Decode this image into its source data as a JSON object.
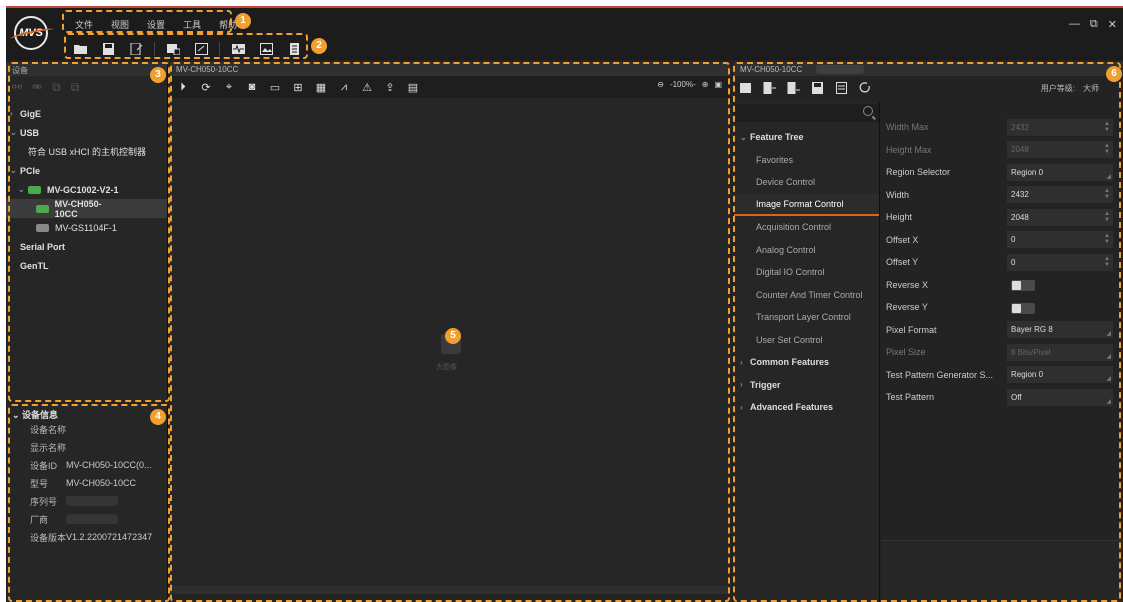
{
  "menu": [
    "文件",
    "视图",
    "设置",
    "工具",
    "帮助"
  ],
  "toolbar_icons": [
    "open-folder-icon",
    "save-icon",
    "save-as-icon",
    "import-icon",
    "fullscreen-icon",
    "waveform-icon",
    "image-export-icon",
    "document-icon"
  ],
  "window_controls": {
    "minimize": "—",
    "restore": "⧉",
    "close": "✕"
  },
  "annotations": [
    "1",
    "2",
    "3",
    "4",
    "5",
    "6"
  ],
  "device_panel": {
    "title": "设备",
    "tree": [
      {
        "label": "GigE",
        "level": 0,
        "caret": "›",
        "bold": true
      },
      {
        "label": "USB",
        "level": 0,
        "caret": "⌄",
        "bold": true
      },
      {
        "label": "符合 USB xHCI 的主机控制器",
        "level": 1,
        "caret": "",
        "bold": false
      },
      {
        "label": "PCIe",
        "level": 0,
        "caret": "⌄",
        "bold": true
      },
      {
        "label": "MV-GC1002-V2-1",
        "level": 1,
        "caret": "⌄",
        "bold": true,
        "icon": "green"
      },
      {
        "label": "MV-CH050-10CC",
        "level": 2,
        "caret": "",
        "bold": true,
        "icon": "green",
        "selected": true,
        "blurred": true
      },
      {
        "label": "MV-GS1104F-1",
        "level": 2,
        "caret": "",
        "bold": false,
        "icon": "gray"
      },
      {
        "label": "Serial Port",
        "level": 0,
        "caret": "",
        "bold": true
      },
      {
        "label": "GenTL",
        "level": 0,
        "caret": "",
        "bold": true
      }
    ]
  },
  "device_info": {
    "title": "设备信息",
    "rows": [
      {
        "key": "设备名称",
        "value": ""
      },
      {
        "key": "显示名称",
        "value": ""
      },
      {
        "key": "设备ID",
        "value": "MV-CH050-10CC(0..."
      },
      {
        "key": "型号",
        "value": "MV-CH050-10CC"
      },
      {
        "key": "序列号",
        "value": "",
        "blurred": true
      },
      {
        "key": "厂商",
        "value": "",
        "blurred": true
      },
      {
        "key": "设备版本",
        "value": "V1.2.2200721472347"
      }
    ]
  },
  "image_panel": {
    "title": "MV-CH050-10CC",
    "zoom": "-100%-",
    "placeholder": "大图像"
  },
  "props_panel": {
    "title": "MV-CH050-10CC",
    "user_level_label": "用户等级:",
    "user_level_value": "大师",
    "feature_tree": [
      {
        "label": "Feature Tree",
        "header": true,
        "caret": "⌄"
      },
      {
        "label": "Favorites"
      },
      {
        "label": "Device Control"
      },
      {
        "label": "Image Format Control",
        "selected": true
      },
      {
        "label": "Acquisition Control"
      },
      {
        "label": "Analog Control"
      },
      {
        "label": "Digital IO Control"
      },
      {
        "label": "Counter And Timer Control"
      },
      {
        "label": "Transport Layer Control"
      },
      {
        "label": "User Set Control"
      },
      {
        "label": "Common Features",
        "header": true,
        "caret": "›"
      },
      {
        "label": "Trigger",
        "header": true,
        "caret": "›"
      },
      {
        "label": "Advanced Features",
        "header": true,
        "caret": "›"
      }
    ],
    "properties": [
      {
        "name": "Width Max",
        "value": "2432",
        "dim": true,
        "ctrl": "spin"
      },
      {
        "name": "Height Max",
        "value": "2048",
        "dim": true,
        "ctrl": "spin"
      },
      {
        "name": "Region Selector",
        "value": "Region 0",
        "ctrl": "combo"
      },
      {
        "name": "Width",
        "value": "2432",
        "ctrl": "spin"
      },
      {
        "name": "Height",
        "value": "2048",
        "ctrl": "spin"
      },
      {
        "name": "Offset X",
        "value": "0",
        "ctrl": "spin"
      },
      {
        "name": "Offset Y",
        "value": "0",
        "ctrl": "spin"
      },
      {
        "name": "Reverse X",
        "value": "",
        "ctrl": "toggle"
      },
      {
        "name": "Reverse Y",
        "value": "",
        "ctrl": "toggle"
      },
      {
        "name": "Pixel Format",
        "value": "Bayer RG 8",
        "ctrl": "combo"
      },
      {
        "name": "Pixel Size",
        "value": "8 Bits/Pixel",
        "dim": true,
        "ctrl": "combo"
      },
      {
        "name": "Test Pattern Generator S...",
        "value": "Region 0",
        "ctrl": "combo"
      },
      {
        "name": "Test Pattern",
        "value": "Off",
        "ctrl": "combo"
      }
    ]
  },
  "colors": {
    "accent": "#f0a030",
    "selected_underline": "#d8651a",
    "device_ok": "#4ba84b"
  }
}
